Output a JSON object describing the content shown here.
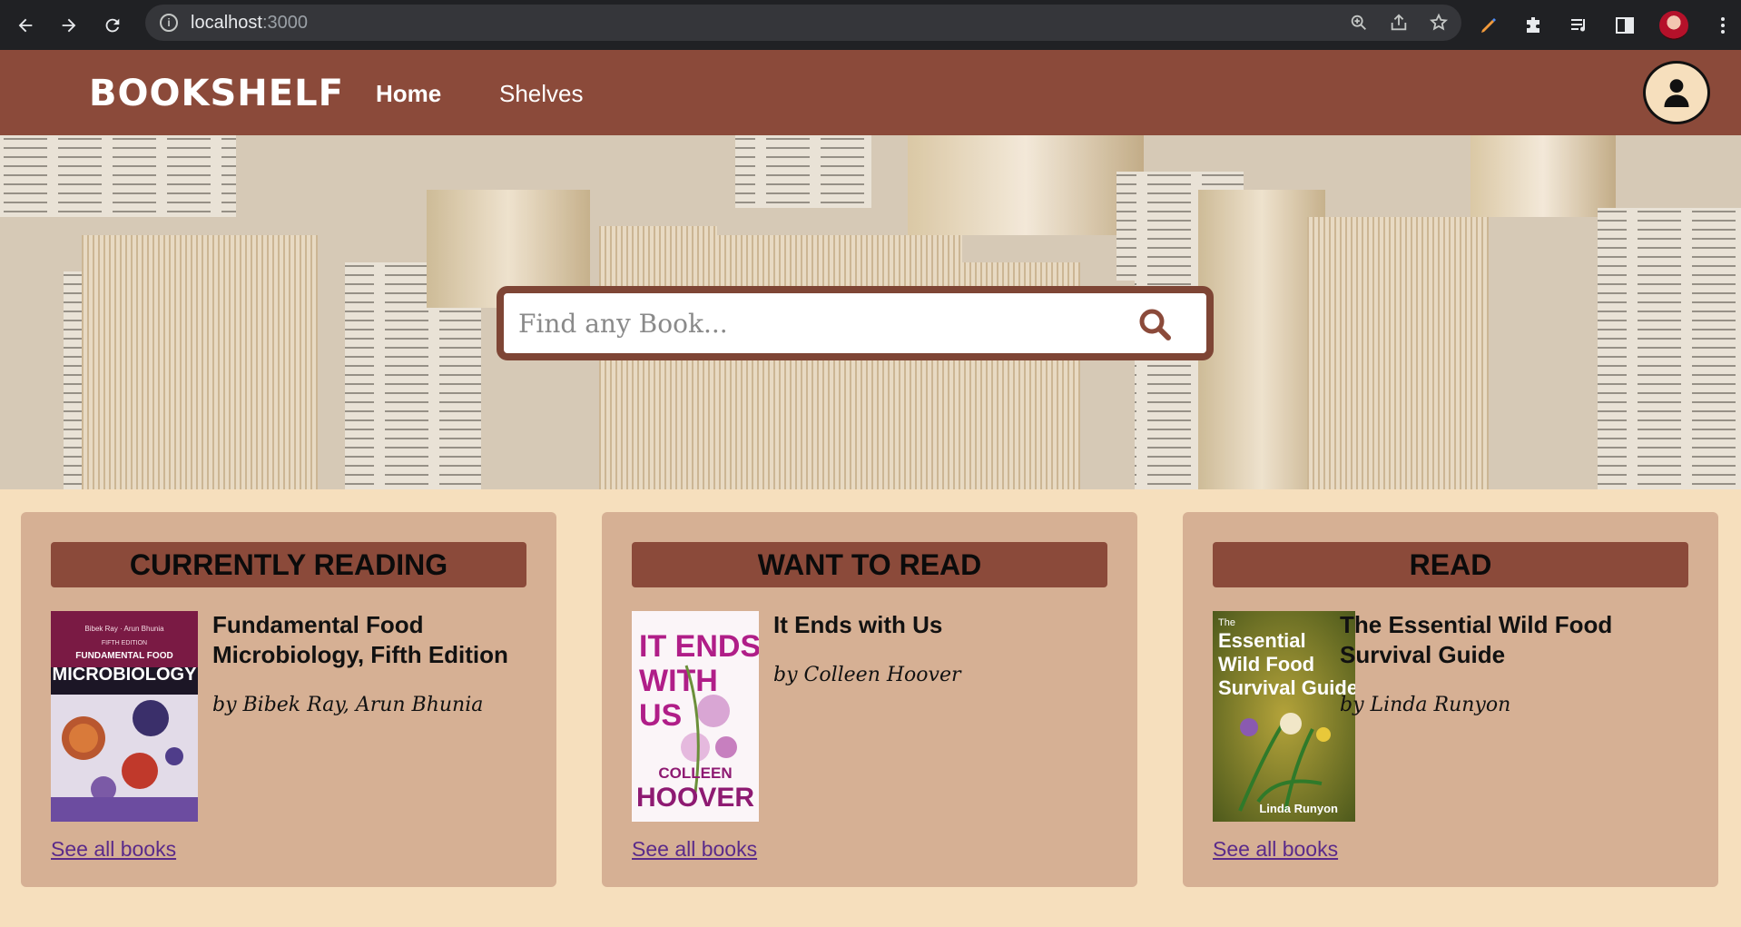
{
  "browser": {
    "url_host": "localhost",
    "url_port": ":3000"
  },
  "app": {
    "logo": "BOOKSHELF",
    "nav": {
      "home": "Home",
      "shelves": "Shelves"
    }
  },
  "search": {
    "placeholder": "Find any Book..."
  },
  "shelves": [
    {
      "title": "CURRENTLY READING",
      "book_title": "Fundamental Food Microbiology, Fifth Edition",
      "book_author": "by Bibek Ray, Arun Bhunia",
      "cover_top": "Bibek Ray · Arun Bhunia",
      "cover_edition": "FIFTH EDITION",
      "cover_main_1": "FUNDAMENTAL FOOD",
      "cover_main_2": "MICROBIOLOGY",
      "link": "See all books"
    },
    {
      "title": "WANT TO READ",
      "book_title": "It Ends with Us",
      "book_author": "by Colleen Hoover",
      "cover_main_1": "IT ENDS",
      "cover_main_2": "WITH",
      "cover_main_3": "US",
      "cover_author_1": "COLLEEN",
      "cover_author_2": "HOOVER",
      "link": "See all books"
    },
    {
      "title": "READ",
      "book_title": "The Essential Wild Food Survival Guide",
      "book_author": "by Linda Runyon",
      "cover_line_1": "The",
      "cover_line_2": "Essential",
      "cover_line_3": "Wild Food",
      "cover_line_4": "Survival Guide",
      "cover_author": "Linda Runyon",
      "link": "See all books"
    }
  ],
  "colors": {
    "header": "#8b4a3a",
    "page_bg": "#f6dfbd",
    "card_bg": "#d6b094"
  }
}
